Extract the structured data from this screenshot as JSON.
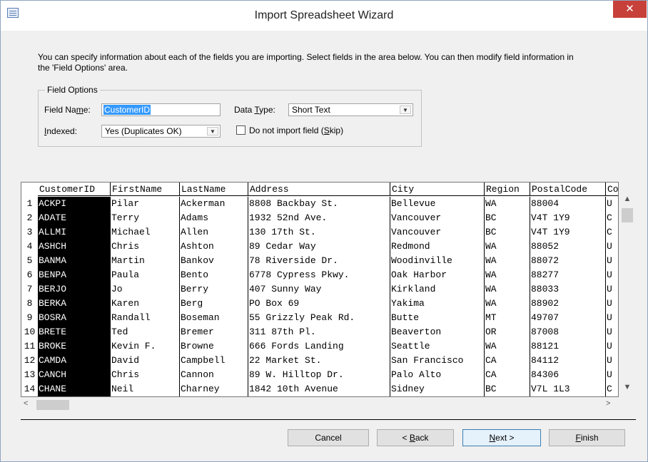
{
  "window": {
    "title": "Import Spreadsheet Wizard",
    "close_glyph": "✕"
  },
  "intro": "You can specify information about each of the fields you are importing. Select fields in the area below. You can then modify field information in the 'Field Options' area.",
  "field_options": {
    "legend": "Field Options",
    "field_name_label": {
      "pre": "Field Na",
      "key": "m",
      "post": "e:"
    },
    "field_name_value": "CustomerID",
    "data_type_label": {
      "pre": "Data ",
      "key": "T",
      "post": "ype:"
    },
    "data_type_value": "Short Text",
    "indexed_label": {
      "pre": "",
      "key": "I",
      "post": "ndexed:"
    },
    "indexed_value": "Yes (Duplicates OK)",
    "skip_label": {
      "pre": "Do not import field (",
      "key": "S",
      "post": "kip)"
    },
    "skip_checked": false
  },
  "table": {
    "columns": [
      "CustomerID",
      "FirstName",
      "LastName",
      "Address",
      "City",
      "Region",
      "PostalCode",
      "Co"
    ],
    "rows": [
      [
        "1",
        "ACKPI",
        "Pilar",
        "Ackerman",
        "8808 Backbay St.",
        "Bellevue",
        "WA",
        "88004",
        "U"
      ],
      [
        "2",
        "ADATE",
        "Terry",
        "Adams",
        "1932 52nd Ave.",
        "Vancouver",
        "BC",
        "V4T 1Y9",
        "C"
      ],
      [
        "3",
        "ALLMI",
        "Michael",
        "Allen",
        "130 17th St.",
        "Vancouver",
        "BC",
        "V4T 1Y9",
        "C"
      ],
      [
        "4",
        "ASHCH",
        "Chris",
        "Ashton",
        "89 Cedar Way",
        "Redmond",
        "WA",
        "88052",
        "U"
      ],
      [
        "5",
        "BANMA",
        "Martin",
        "Bankov",
        "78 Riverside Dr.",
        "Woodinville",
        "WA",
        "88072",
        "U"
      ],
      [
        "6",
        "BENPA",
        "Paula",
        "Bento",
        "6778 Cypress Pkwy.",
        "Oak Harbor",
        "WA",
        "88277",
        "U"
      ],
      [
        "7",
        "BERJO",
        "Jo",
        "Berry",
        "407 Sunny Way",
        "Kirkland",
        "WA",
        "88033",
        "U"
      ],
      [
        "8",
        "BERKA",
        "Karen",
        "Berg",
        "PO Box 69",
        "Yakima",
        "WA",
        "88902",
        "U"
      ],
      [
        "9",
        "BOSRA",
        "Randall",
        "Boseman",
        "55 Grizzly Peak Rd.",
        "Butte",
        "MT",
        "49707",
        "U"
      ],
      [
        "10",
        "BRETE",
        "Ted",
        "Bremer",
        "311 87th Pl.",
        "Beaverton",
        "OR",
        "87008",
        "U"
      ],
      [
        "11",
        "BROKE",
        "Kevin F.",
        "Browne",
        "666 Fords Landing",
        "Seattle",
        "WA",
        "88121",
        "U"
      ],
      [
        "12",
        "CAMDA",
        "David",
        "Campbell",
        "22 Market St.",
        "San Francisco",
        "CA",
        "84112",
        "U"
      ],
      [
        "13",
        "CANCH",
        "Chris",
        "Cannon",
        "89 W. Hilltop Dr.",
        "Palo Alto",
        "CA",
        "84306",
        "U"
      ],
      [
        "14",
        "CHANE",
        "Neil",
        "Charney",
        "1842 10th Avenue",
        "Sidney",
        "BC",
        "V7L 1L3",
        "C"
      ]
    ]
  },
  "scroll": {
    "up": "▲",
    "down": "▼",
    "left": "<",
    "right": ">"
  },
  "buttons": {
    "cancel": {
      "pre": "Cancel",
      "key": "",
      "post": ""
    },
    "back": {
      "pre": "< ",
      "key": "B",
      "post": "ack"
    },
    "next": {
      "pre": "",
      "key": "N",
      "post": "ext >"
    },
    "finish": {
      "pre": "",
      "key": "F",
      "post": "inish"
    }
  }
}
